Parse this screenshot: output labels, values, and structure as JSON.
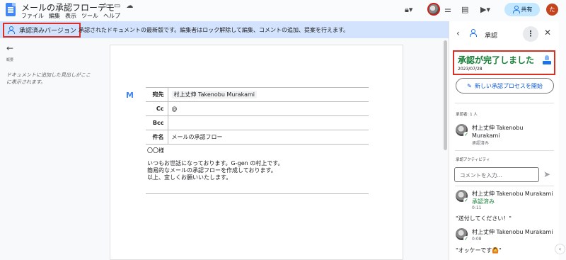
{
  "app": {
    "title": "メールの承認フローデモ",
    "menu": [
      "ファイル",
      "編集",
      "表示",
      "ツール",
      "ヘルプ"
    ],
    "share_label": "共有",
    "user_initial": "た"
  },
  "banner": {
    "tag_label": "承認済みバージョン",
    "message": "承認されたドキュメントの最新版です。編集者はロック解除して編集、コメントの追加、提案を行えます。"
  },
  "outline": {
    "label": "概要",
    "hint": "ドキュメントに追加した見出しがここに表示されます。"
  },
  "document": {
    "fields": [
      {
        "label": "宛先",
        "value": "村上丈伸 Takenobu Murakami"
      },
      {
        "label": "Cc",
        "value": "@"
      },
      {
        "label": "Bcc",
        "value": ""
      },
      {
        "label": "件名",
        "value": "メールの承認フロー"
      }
    ],
    "salutation": "〇〇様",
    "body_lines": [
      "いつもお世話になっております。G-gen の村上です。",
      "簡易的なメールの承認フローを作成しております。",
      "以上、宜しくお願いいたします。"
    ]
  },
  "panel": {
    "title": "承認",
    "status_title": "承認が完了しました",
    "status_date": "2023/07/28",
    "new_button": "新しい承認プロセスを開始",
    "approvers_label": "承認者: 1 人",
    "approver_name": "村上丈伸 Takenobu Murakami",
    "approver_status": "承認済み",
    "activity_label": "承認アクティビティ",
    "comment_placeholder": "コメントを入力...",
    "activities": [
      {
        "name": "村上丈伸 Takenobu Murakami",
        "action": "承認済み",
        "time": "0:11",
        "quote": "\"送付してください！\""
      },
      {
        "name": "村上丈伸 Takenobu Murakami",
        "action": "",
        "time": "0:08",
        "quote": "\"オッケーです🙆\""
      }
    ]
  },
  "colors": {
    "accent": "#1a73e8",
    "approved_green": "#188038",
    "banner_bg": "#d3e3fd",
    "highlight_red": "#d93025"
  }
}
